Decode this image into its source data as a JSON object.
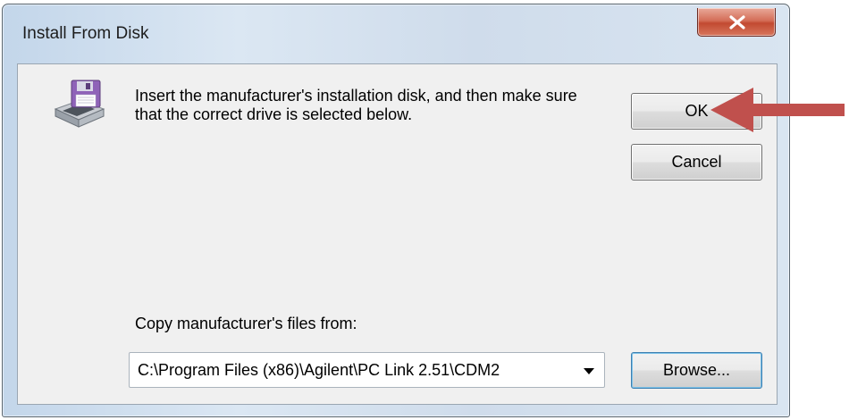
{
  "window": {
    "title": "Install From Disk"
  },
  "message": "Insert the manufacturer's installation disk, and then make sure that the correct drive is selected below.",
  "buttons": {
    "ok": "OK",
    "cancel": "Cancel",
    "browse": "Browse..."
  },
  "copy_from": {
    "label": "Copy manufacturer's files from:",
    "value": "C:\\Program Files (x86)\\Agilent\\PC Link 2.51\\CDM2"
  },
  "icons": {
    "close": "close-icon",
    "disk": "install-disk-icon",
    "dropdown": "chevron-down-icon",
    "annotation": "red-arrow-icon"
  },
  "colors": {
    "close_button": "#c9503a",
    "annotation_arrow": "#c0504d",
    "dialog_face": "#f0f0f0"
  }
}
